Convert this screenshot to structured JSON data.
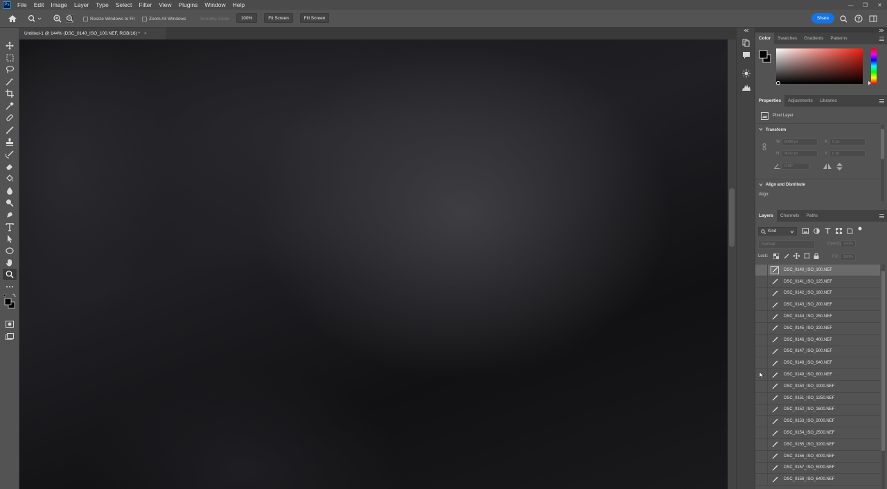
{
  "app": {
    "logo_text": "Ps"
  },
  "menu": [
    "File",
    "Edit",
    "Image",
    "Layer",
    "Type",
    "Select",
    "Filter",
    "View",
    "Plugins",
    "Window",
    "Help"
  ],
  "window_controls": [
    "—",
    "❐",
    "✕"
  ],
  "options": {
    "resize_windows": "Resize Windows to Fit",
    "zoom_all": "Zoom All Windows",
    "scrubby_zoom": "Scrubby Zoom",
    "zoom_value": "100%",
    "fit_screen": "Fit Screen",
    "fill_screen": "Fill Screen",
    "share": "Share"
  },
  "document": {
    "tab_title": "Untitled-1 @ 144% (DSC_0140_ISO_100.NEF, RGB/16) *",
    "close": "×"
  },
  "color_panel": {
    "tabs": [
      "Color",
      "Swatches",
      "Gradients",
      "Patterns"
    ],
    "hue_color": "#f02010"
  },
  "properties": {
    "tabs": [
      "Properties",
      "Adjustments",
      "Libraries"
    ],
    "layer_type": "Pixel Layer",
    "transform_label": "Transform",
    "w_label": "W",
    "w_value": "6048 px",
    "h_label": "H",
    "h_value": "4032 px",
    "x_label": "X",
    "x_value": "0 px",
    "y_label": "Y",
    "y_value": "0 px",
    "angle_value": "0.00°",
    "align_label": "Align and Distribute",
    "align_sub": "Align:"
  },
  "layers_panel": {
    "tabs": [
      "Layers",
      "Channels",
      "Paths"
    ],
    "filter_kind": "Kind",
    "blend_mode": "Normal",
    "opacity_label": "Opacity:",
    "opacity_value": "100%",
    "lock_label": "Lock:",
    "fill_label": "Fill:",
    "fill_value": "100%",
    "layers": [
      "DSC_0140_ISO_100.NEF",
      "DSC_0141_ISO_125.NEF",
      "DSC_0142_ISO_160.NEF",
      "DSC_0143_ISO_200.NEF",
      "DSC_0144_ISO_250.NEF",
      "DSC_0145_ISO_320.NEF",
      "DSC_0146_ISO_400.NEF",
      "DSC_0147_ISO_500.NEF",
      "DSC_0148_ISO_640.NEF",
      "DSC_0149_ISO_800.NEF",
      "DSC_0150_ISO_1000.NEF",
      "DSC_0151_ISO_1250.NEF",
      "DSC_0152_ISO_1600.NEF",
      "DSC_0153_ISO_2000.NEF",
      "DSC_0154_ISO_2500.NEF",
      "DSC_0155_ISO_3200.NEF",
      "DSC_0156_ISO_4000.NEF",
      "DSC_0157_ISO_5000.NEF",
      "DSC_0158_ISO_6400.NEF"
    ]
  }
}
